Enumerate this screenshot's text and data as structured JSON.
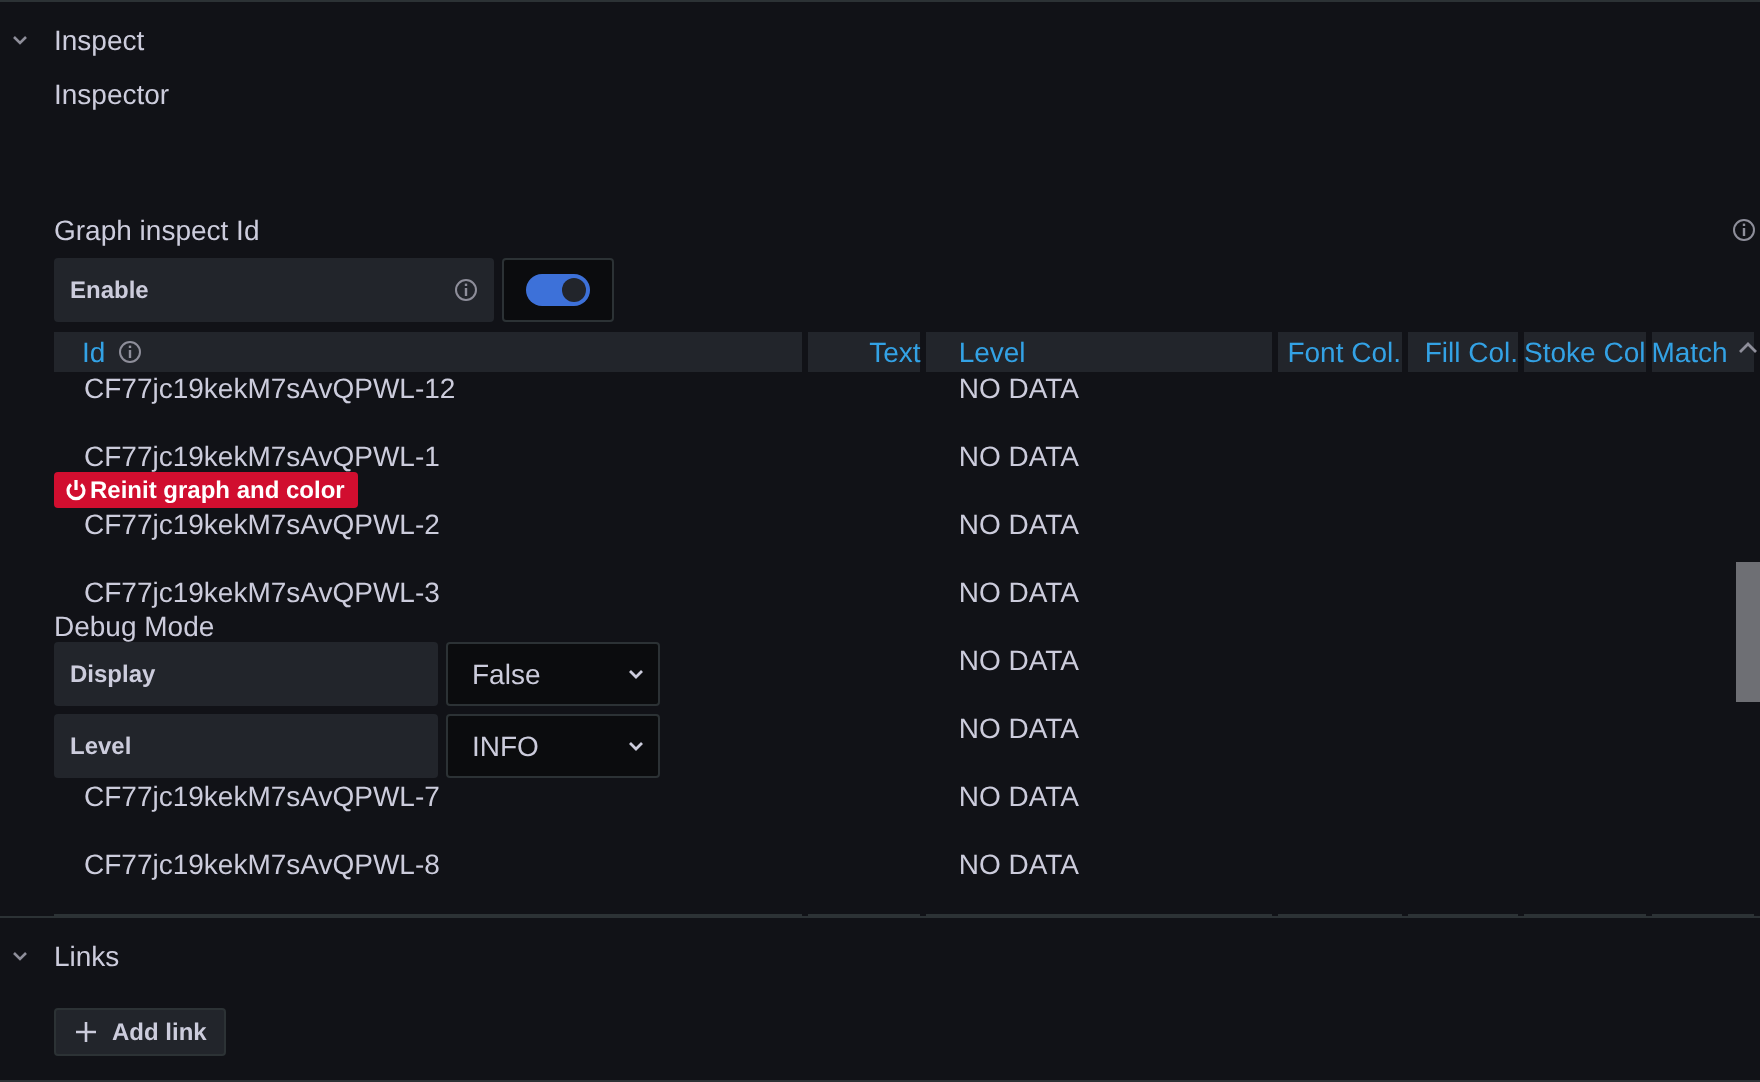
{
  "inspect": {
    "title": "Inspect",
    "expanded": true,
    "subtitle": "Inspector",
    "graph_inspect": {
      "label": "Graph inspect Id",
      "enable": {
        "label": "Enable",
        "on": true
      }
    },
    "table": {
      "columns": [
        "Id",
        "Text",
        "Level",
        "Font Col.",
        "Fill Col.",
        "Stoke Col",
        "Match"
      ],
      "rows": [
        {
          "id": "CF77jc19kekM7sAvQPWL-12",
          "level": "NO DATA"
        },
        {
          "id": "CF77jc19kekM7sAvQPWL-1",
          "level": "NO DATA"
        },
        {
          "id": "CF77jc19kekM7sAvQPWL-2",
          "level": "NO DATA"
        },
        {
          "id": "CF77jc19kekM7sAvQPWL-3",
          "level": "NO DATA"
        },
        {
          "level": "NO DATA"
        },
        {
          "level": "NO DATA"
        },
        {
          "id": "CF77jc19kekM7sAvQPWL-7",
          "level": "NO DATA"
        },
        {
          "id": "CF77jc19kekM7sAvQPWL-8",
          "level": "NO DATA"
        }
      ]
    },
    "reinit_button": "Reinit graph and color",
    "debug_mode": {
      "title": "Debug Mode",
      "fields": [
        {
          "label": "Display",
          "value": "False"
        },
        {
          "label": "Level",
          "value": "INFO"
        }
      ]
    }
  },
  "links": {
    "title": "Links",
    "expanded": true,
    "add_button": "Add link"
  }
}
